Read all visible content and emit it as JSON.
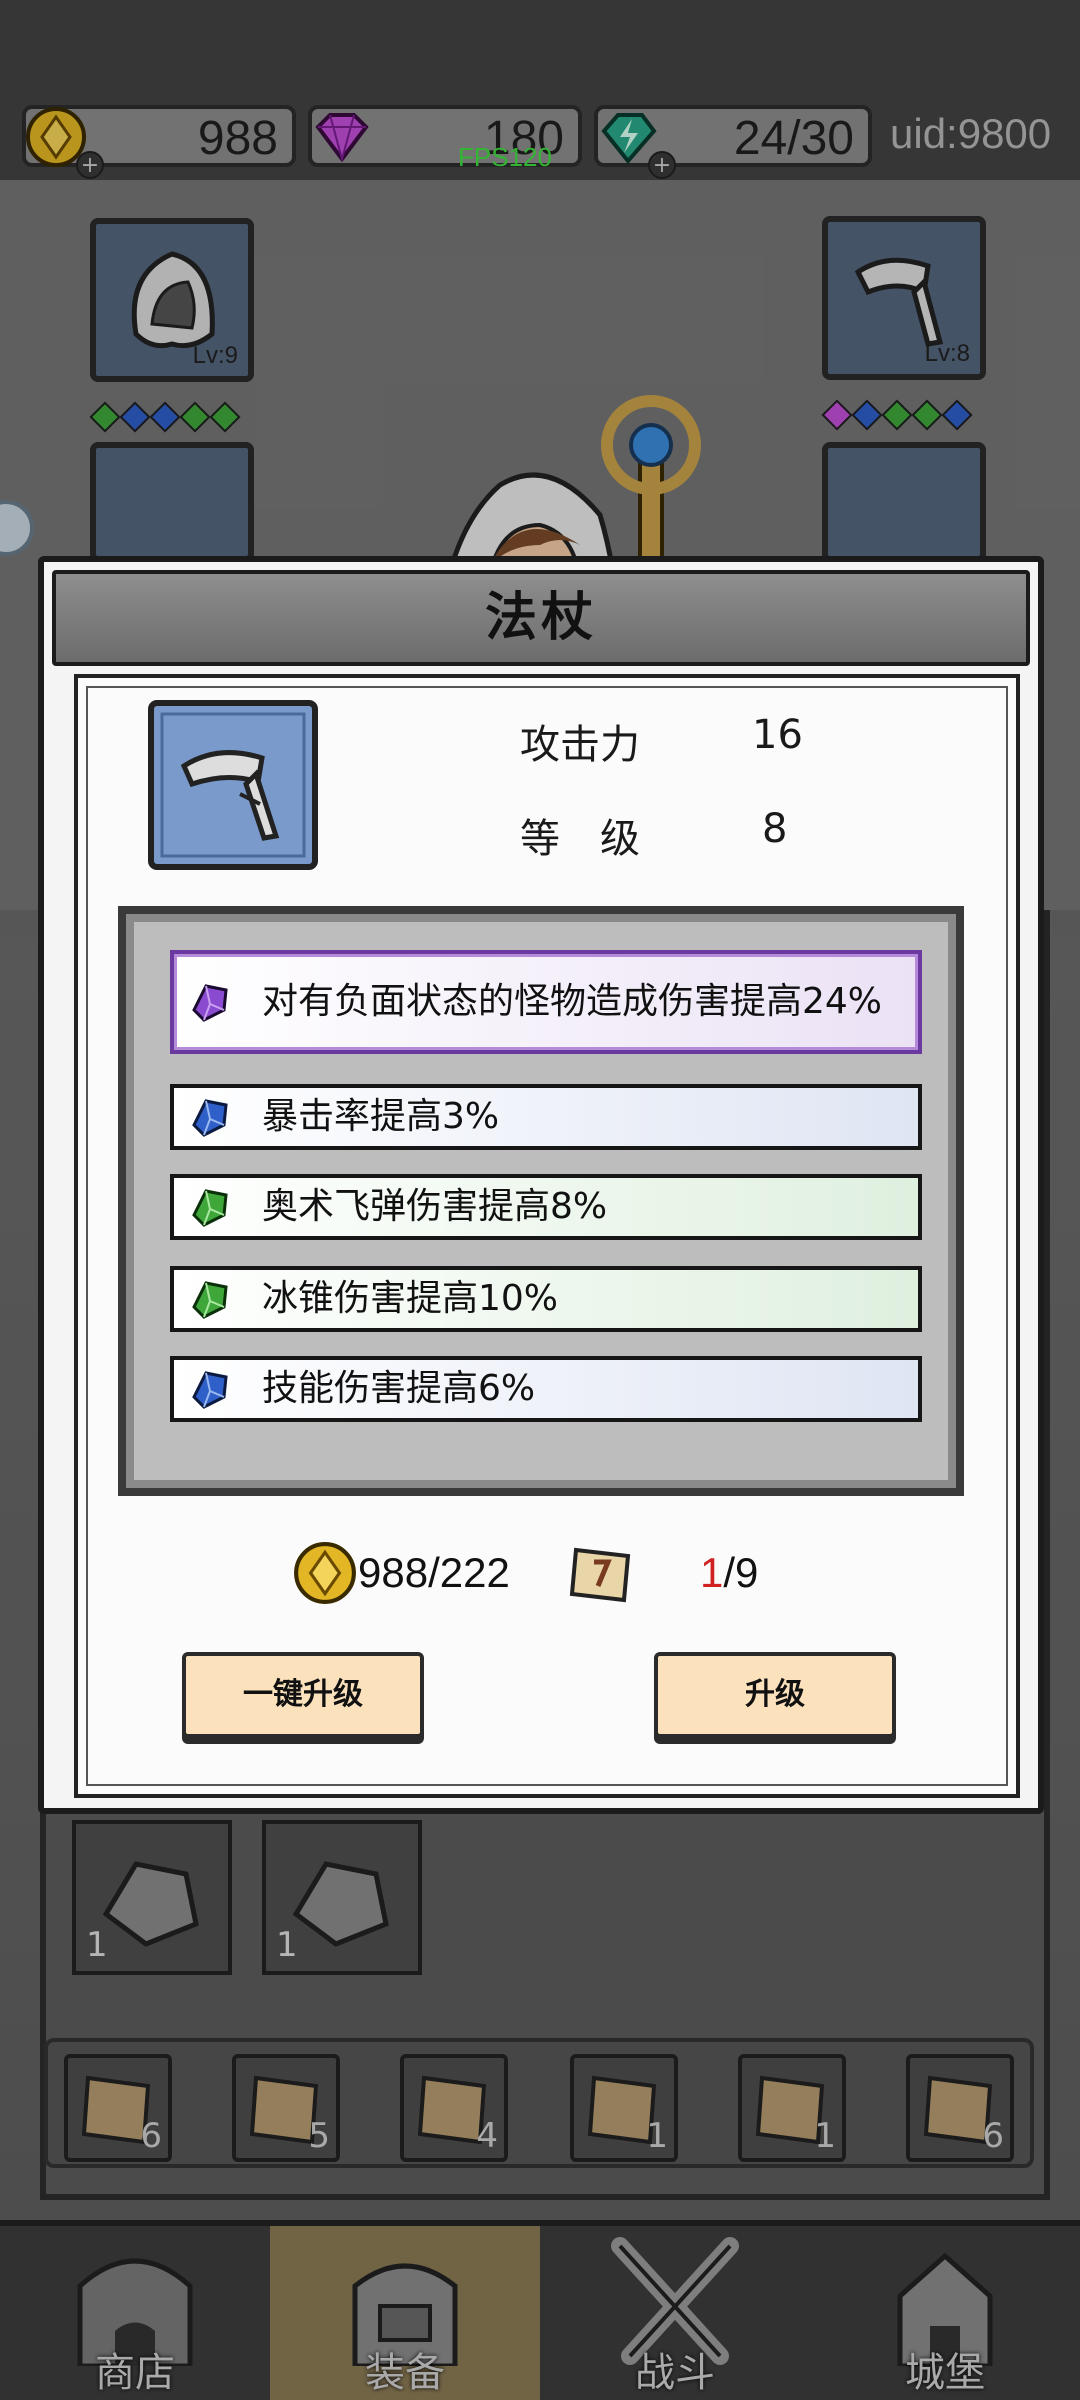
{
  "resources": {
    "gold": "988",
    "gems": "180",
    "energy": "24/30",
    "uid": "uid:9800",
    "fps": "FPS120"
  },
  "equipment": {
    "helmet_level": "Lv:9",
    "weapon_level": "Lv:8"
  },
  "modal": {
    "title": "法杖",
    "attack_label": "攻击力",
    "attack_value": "16",
    "level_label": "等　级",
    "level_value": "8",
    "attributes": [
      {
        "gem": "purple",
        "text": "对有负面状态的怪物造成伤害提高24%"
      },
      {
        "gem": "blue",
        "text": "暴击率提高3%"
      },
      {
        "gem": "green",
        "text": "奥术飞弹伤害提高8%"
      },
      {
        "gem": "green",
        "text": "冰锥伤害提高10%"
      },
      {
        "gem": "blue",
        "text": "技能伤害提高6%"
      }
    ],
    "gold_cost": "988/222",
    "scroll_have": "1",
    "scroll_need": "/9",
    "btn_one_key": "一键升级",
    "btn_upgrade": "升级"
  },
  "materials": [
    {
      "count": "1"
    },
    {
      "count": "1"
    }
  ],
  "scrolls": [
    {
      "count": "6"
    },
    {
      "count": "5"
    },
    {
      "count": "4"
    },
    {
      "count": "1"
    },
    {
      "count": "1"
    },
    {
      "count": "6"
    }
  ],
  "nav": {
    "shop": "商店",
    "equipment": "装备",
    "battle": "战斗",
    "castle": "城堡"
  },
  "colors": {
    "gold_coin": "#e2b624",
    "gem_purple": "#8a4bd0",
    "gem_blue": "#2f5fc8",
    "gem_green": "#3fa63a",
    "button_bg": "#fbe2bd",
    "scroll_have_red": "#d02020",
    "fps_green": "#3fdc3f"
  }
}
